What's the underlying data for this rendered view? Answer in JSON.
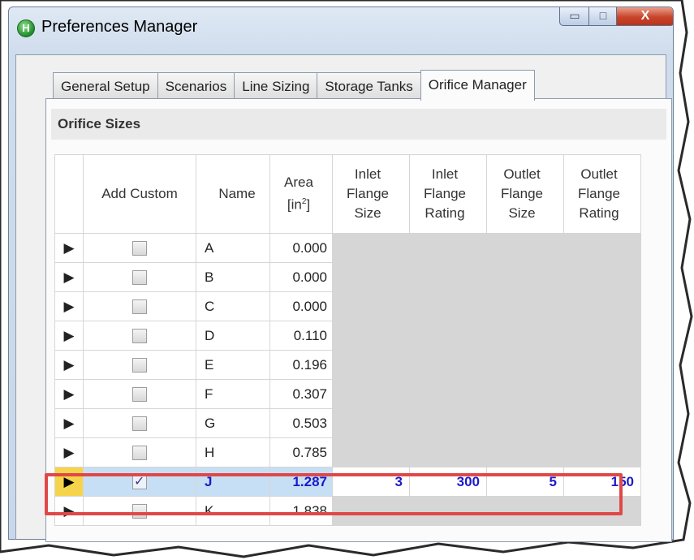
{
  "window": {
    "title": "Preferences Manager",
    "controls": {
      "minimize": "▭",
      "maximize": "□",
      "close": "X"
    }
  },
  "tabs": [
    {
      "label": "General Setup",
      "active": false
    },
    {
      "label": "Scenarios",
      "active": false
    },
    {
      "label": "Line Sizing",
      "active": false
    },
    {
      "label": "Storage Tanks",
      "active": false
    },
    {
      "label": "Orifice Manager",
      "active": true
    }
  ],
  "section": {
    "title": "Orifice Sizes"
  },
  "table": {
    "headers": {
      "add_custom": "Add Custom",
      "name": "Name",
      "area_line1": "Area",
      "area_line2": "[in",
      "area_sup": "2",
      "area_close": "]",
      "inlet_size": [
        "Inlet",
        "Flange",
        "Size"
      ],
      "inlet_rating": [
        "Inlet",
        "Flange",
        "Rating"
      ],
      "outlet_size": [
        "Outlet",
        "Flange",
        "Size"
      ],
      "outlet_rating": [
        "Outlet",
        "Flange",
        "Rating"
      ]
    },
    "rows": [
      {
        "name": "A",
        "area": "0.000",
        "custom": false
      },
      {
        "name": "B",
        "area": "0.000",
        "custom": false
      },
      {
        "name": "C",
        "area": "0.000",
        "custom": false
      },
      {
        "name": "D",
        "area": "0.110",
        "custom": false
      },
      {
        "name": "E",
        "area": "0.196",
        "custom": false
      },
      {
        "name": "F",
        "area": "0.307",
        "custom": false
      },
      {
        "name": "G",
        "area": "0.503",
        "custom": false
      },
      {
        "name": "H",
        "area": "0.785",
        "custom": false
      },
      {
        "name": "J",
        "area": "1.287",
        "custom": true,
        "selected": true,
        "inlet_size": "3",
        "inlet_rating": "300",
        "outlet_size": "5",
        "outlet_rating": "150"
      },
      {
        "name": "K",
        "area": "1.838",
        "custom": false
      }
    ]
  },
  "colors": {
    "highlight": "#e04848",
    "selected_row": "#c7dff4",
    "row_pointer": "#f5d44b"
  }
}
